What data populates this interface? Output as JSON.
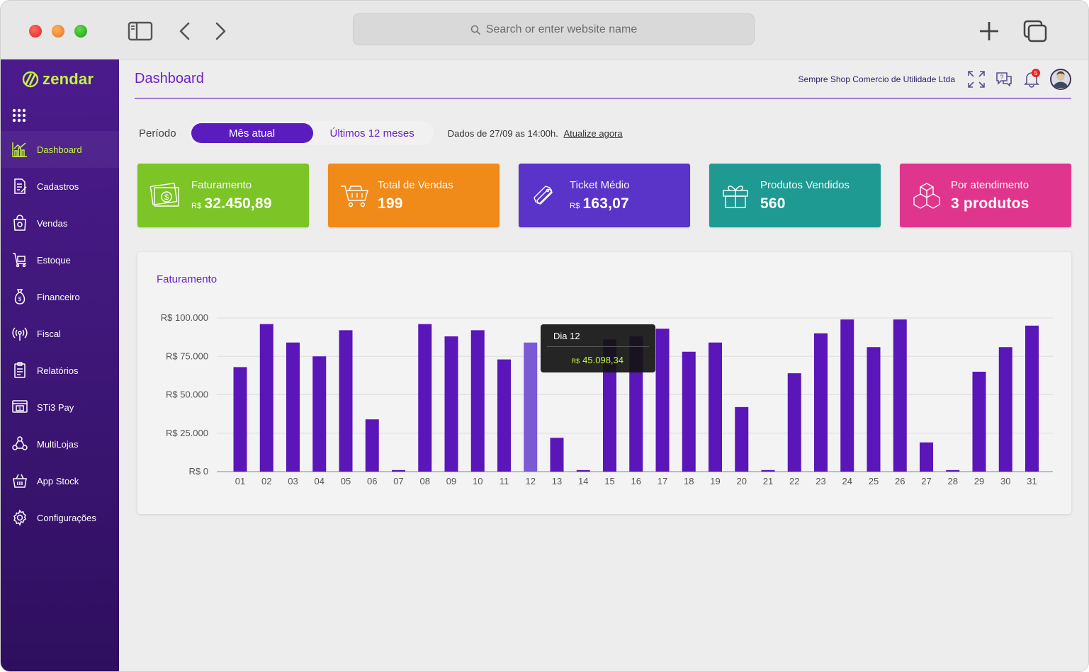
{
  "browser": {
    "address_placeholder": "Search or enter website name"
  },
  "brand": {
    "name": "zendar",
    "accent": "#c4f33e",
    "primary": "#5b1cbf"
  },
  "sidebar": {
    "items": [
      {
        "label": "Dashboard",
        "icon": "chart-icon",
        "active": true
      },
      {
        "label": "Cadastros",
        "icon": "document-edit-icon"
      },
      {
        "label": "Vendas",
        "icon": "shopping-bag-icon"
      },
      {
        "label": "Estoque",
        "icon": "cart-box-icon"
      },
      {
        "label": "Financeiro",
        "icon": "money-bag-icon"
      },
      {
        "label": "Fiscal",
        "icon": "broadcast-icon"
      },
      {
        "label": "Relatórios",
        "icon": "report-icon"
      },
      {
        "label": "STi3 Pay",
        "icon": "pay-screen-icon"
      },
      {
        "label": "MultiLojas",
        "icon": "multi-store-icon"
      },
      {
        "label": "App Stock",
        "icon": "stock-basket-icon"
      },
      {
        "label": "Configurações",
        "icon": "gear-icon"
      }
    ]
  },
  "header": {
    "title": "Dashboard",
    "company": "Sempre Shop Comercio de Utilidade Ltda",
    "notification_count": "5"
  },
  "period": {
    "label": "Período",
    "options": [
      "Mês atual",
      "Últimos 12 meses"
    ],
    "selected": "Mês atual",
    "info": "Dados de 27/09 as 14:00h.",
    "refresh_link": "Atualize agora"
  },
  "cards": [
    {
      "label": "Faturamento",
      "currency": "R$",
      "value": "32.450,89",
      "color": "#7dc426",
      "icon": "money-icon"
    },
    {
      "label": "Total de Vendas",
      "currency": "",
      "value": "199",
      "color": "#f08a18",
      "icon": "cart-icon"
    },
    {
      "label": "Ticket Médio",
      "currency": "R$",
      "value": "163,07",
      "color": "#5a33c9",
      "icon": "ticket-icon"
    },
    {
      "label": "Produtos Vendidos",
      "currency": "",
      "value": "560",
      "color": "#1e9a93",
      "icon": "gift-icon"
    },
    {
      "label": "Por atendimento",
      "currency": "",
      "value": "3 produtos",
      "color": "#e0358c",
      "icon": "boxes-icon"
    }
  ],
  "tooltip": {
    "title": "Dia 12",
    "currency": "R$",
    "value": "45.098,34"
  },
  "chart_data": {
    "type": "bar",
    "title": "Faturamento",
    "categories": [
      "01",
      "02",
      "03",
      "04",
      "05",
      "06",
      "07",
      "08",
      "09",
      "10",
      "11",
      "12",
      "13",
      "14",
      "15",
      "16",
      "17",
      "18",
      "19",
      "20",
      "21",
      "22",
      "23",
      "24",
      "25",
      "26",
      "27",
      "28",
      "29",
      "30",
      "31"
    ],
    "values": [
      68000,
      96000,
      84000,
      75000,
      92000,
      34000,
      1000,
      96000,
      88000,
      92000,
      73000,
      84000,
      22000,
      1000,
      86000,
      88000,
      93000,
      78000,
      84000,
      42000,
      1000,
      64000,
      90000,
      99000,
      81000,
      99000,
      19000,
      1000,
      65000,
      81000,
      95000
    ],
    "ylim": [
      0,
      100000
    ],
    "yticks": [
      "R$ 0",
      "R$ 25.000",
      "R$ 50.000",
      "R$ 75.000",
      "R$ 100.000"
    ],
    "highlighted": "12",
    "bar_color": "#5a16b8",
    "highlight_color": "#7b5ad6",
    "grid": true
  }
}
